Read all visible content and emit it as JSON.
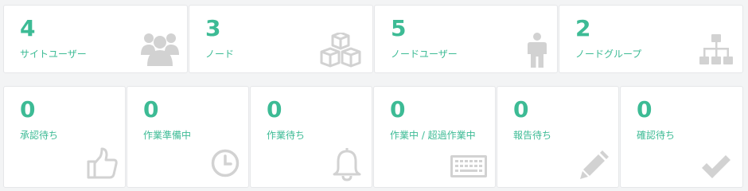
{
  "summary_cards": [
    {
      "value": "4",
      "label": "サイトユーザー",
      "icon": "users-icon"
    },
    {
      "value": "3",
      "label": "ノード",
      "icon": "cubes-icon"
    },
    {
      "value": "5",
      "label": "ノードユーザー",
      "icon": "user-icon"
    },
    {
      "value": "2",
      "label": "ノードグループ",
      "icon": "sitemap-icon"
    }
  ],
  "status_cards": [
    {
      "value": "0",
      "label": "承認待ち",
      "icon": "thumbs-up-icon"
    },
    {
      "value": "0",
      "label": "作業準備中",
      "icon": "clock-icon"
    },
    {
      "value": "0",
      "label": "作業待ち",
      "icon": "bell-icon"
    },
    {
      "value": "0",
      "label": "作業中 / 超過作業中",
      "icon": "keyboard-icon"
    },
    {
      "value": "0",
      "label": "報告待ち",
      "icon": "pencil-icon"
    },
    {
      "value": "0",
      "label": "確認待ち",
      "icon": "check-icon"
    }
  ],
  "colors": {
    "accent": "#3dbb95",
    "icon": "#d2d2d2",
    "background": "#f3f4f5"
  }
}
